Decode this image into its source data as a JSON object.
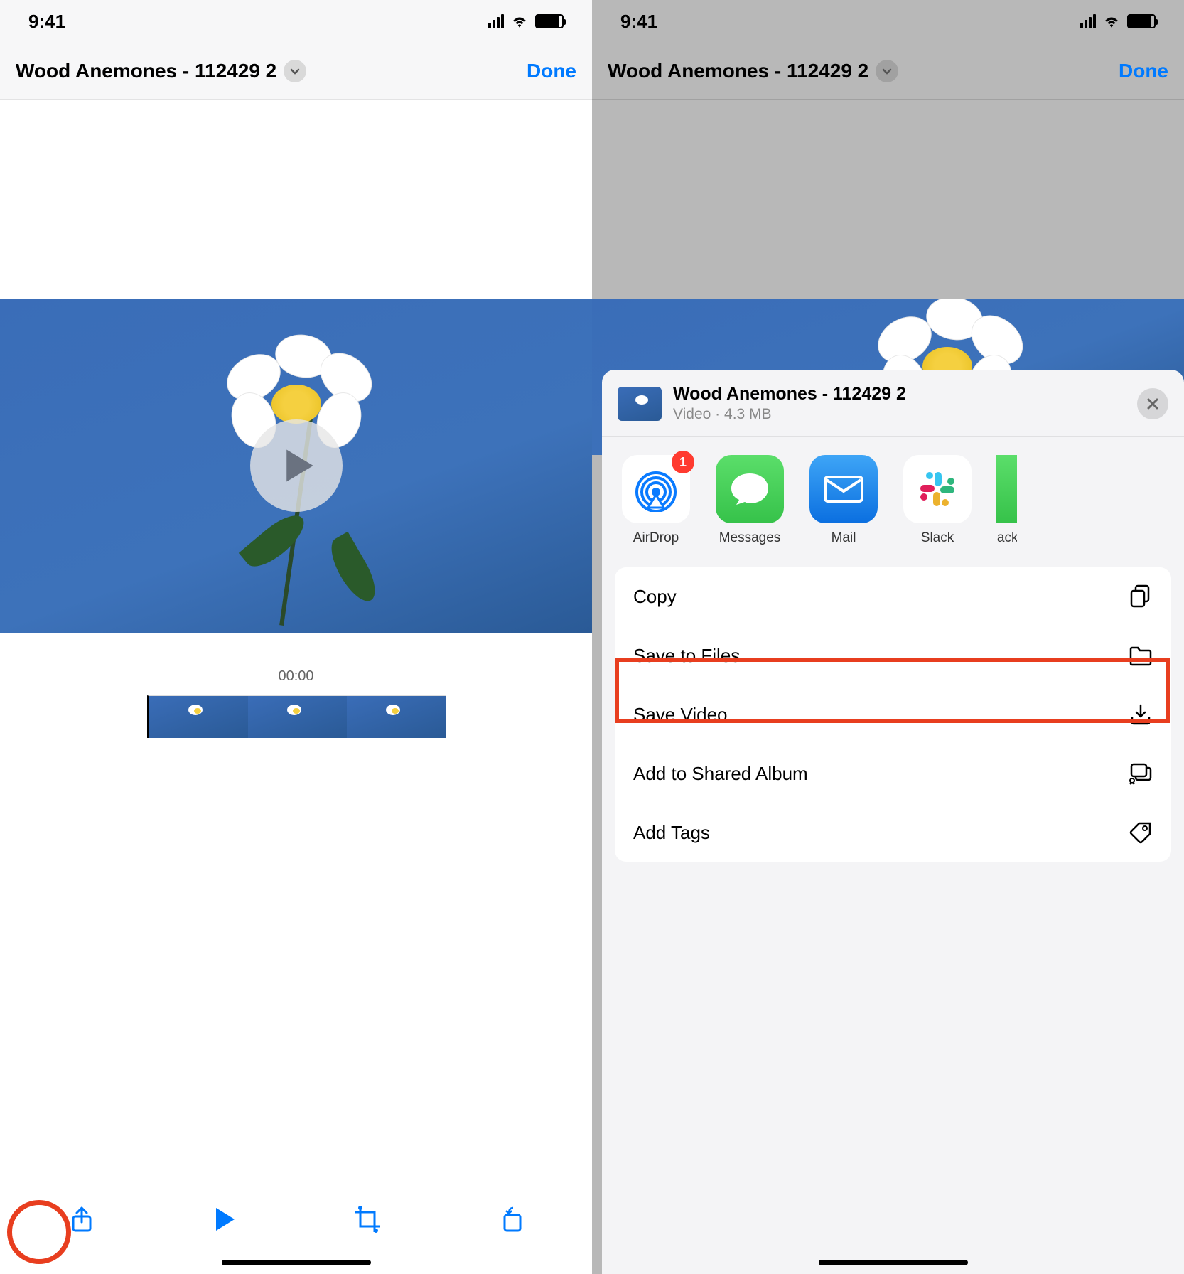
{
  "status": {
    "time": "9:41"
  },
  "nav": {
    "title": "Wood Anemones - 112429 2",
    "done": "Done"
  },
  "timeline": {
    "timecode": "00:00"
  },
  "share": {
    "title": "Wood Anemones - 112429 2",
    "type": "Video",
    "size": "4.3 MB",
    "apps": [
      {
        "label": "AirDrop",
        "badge": "1"
      },
      {
        "label": "Messages"
      },
      {
        "label": "Mail"
      },
      {
        "label": "Slack"
      },
      {
        "label": "Slack"
      }
    ],
    "actions": [
      {
        "label": "Copy",
        "icon": "copy"
      },
      {
        "label": "Save to Files",
        "icon": "folder"
      },
      {
        "label": "Save Video",
        "icon": "download",
        "highlighted": true
      },
      {
        "label": "Add to Shared Album",
        "icon": "shared-album"
      },
      {
        "label": "Add Tags",
        "icon": "tag"
      }
    ]
  }
}
